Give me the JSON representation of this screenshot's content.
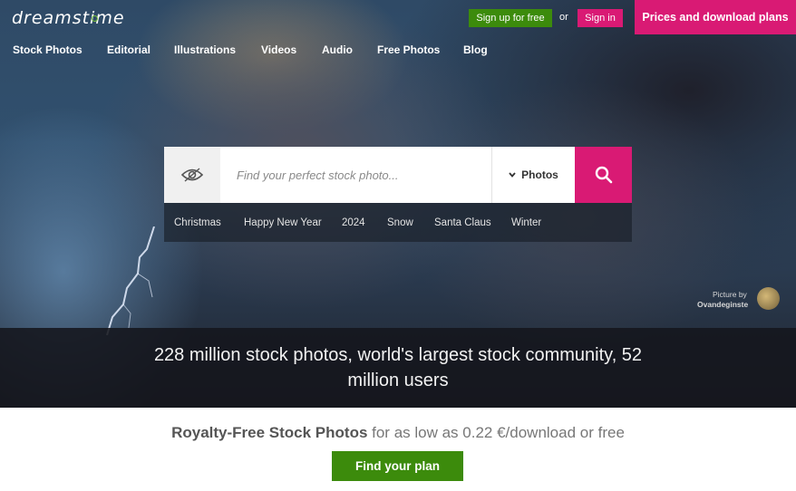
{
  "header": {
    "logo_text": "dreamstime",
    "signup_label": "Sign up for free",
    "or_label": "or",
    "signin_label": "Sign in",
    "prices_label": "Prices and download plans"
  },
  "nav": {
    "items": [
      "Stock Photos",
      "Editorial",
      "Illustrations",
      "Videos",
      "Audio",
      "Free Photos",
      "Blog"
    ]
  },
  "search": {
    "placeholder": "Find your perfect stock photo...",
    "type_selected": "Photos",
    "tags": [
      "Christmas",
      "Happy New Year",
      "2024",
      "Snow",
      "Santa Claus",
      "Winter"
    ]
  },
  "credit": {
    "label": "Picture by",
    "name": "Ovandeginste"
  },
  "banner": {
    "text": "228 million stock photos, world's largest stock community, 52 million users"
  },
  "offer": {
    "bold": "Royalty-Free Stock Photos",
    "rest": " for as low as 0.22 €/download or free",
    "button_label": "Find your plan"
  },
  "colors": {
    "brand_pink": "#d91a74",
    "brand_green": "#3c8b0c",
    "logo_dot": "#79c33b"
  }
}
